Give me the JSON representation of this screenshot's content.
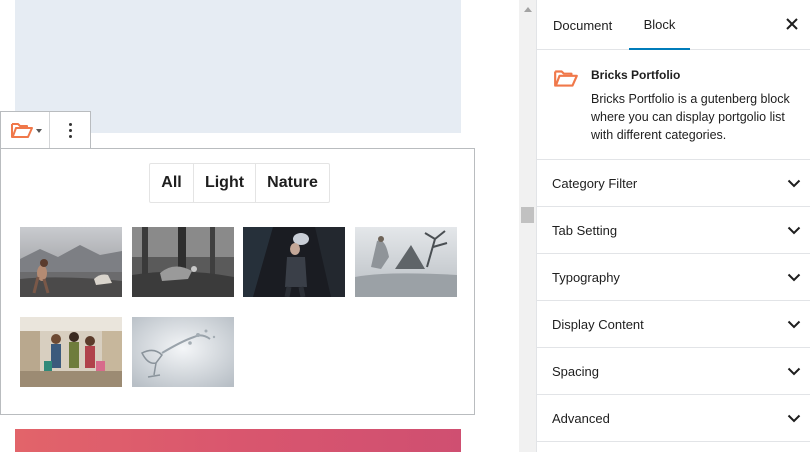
{
  "editor": {
    "block_toolbar": {
      "switcher_icon": "folder-open-icon",
      "more_icon": "vertical-ellipsis-icon"
    },
    "filter_tabs": [
      "All",
      "Light",
      "Nature"
    ],
    "thumbnails": [
      {
        "name": "woman-with-dog-photo"
      },
      {
        "name": "forest-woman-photo"
      },
      {
        "name": "dark-portrait-photo"
      },
      {
        "name": "misty-tree-photo"
      },
      {
        "name": "shopping-girls-photo"
      },
      {
        "name": "wine-glass-splash-photo"
      }
    ]
  },
  "sidebar": {
    "tabs": {
      "document": "Document",
      "block": "Block"
    },
    "active_tab": "Block",
    "close_icon": "close-icon",
    "block_card": {
      "icon": "folder-open-icon",
      "title": "Bricks Portfolio",
      "description": "Bricks Portfolio is a gutenberg block where you can display portgolio list with different categories."
    },
    "panels": [
      {
        "label": "Category Filter"
      },
      {
        "label": "Tab Setting"
      },
      {
        "label": "Typography"
      },
      {
        "label": "Display Content"
      },
      {
        "label": "Spacing"
      },
      {
        "label": "Advanced"
      }
    ]
  },
  "colors": {
    "accent": "#007cba",
    "brand_icon": "#f0784a",
    "placeholder_bg": "#e6ecf3",
    "gradient_start": "#e2646a",
    "gradient_end": "#cf4f71"
  }
}
